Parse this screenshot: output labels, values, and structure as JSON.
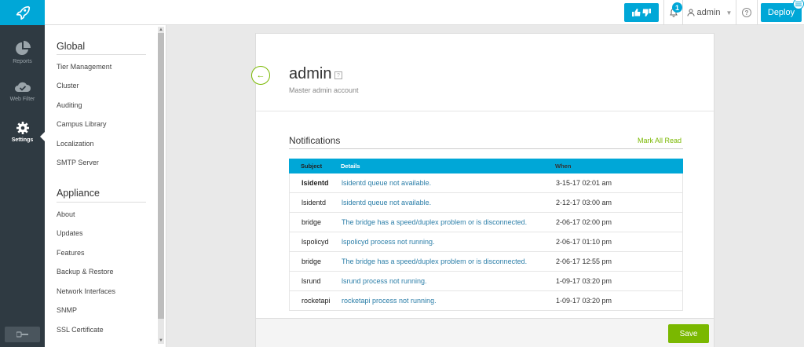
{
  "topbar": {
    "notification_count": "1",
    "user_label": "admin",
    "deploy_label": "Deploy"
  },
  "rail": {
    "items": [
      {
        "label": "Reports",
        "icon": "pie-chart-icon"
      },
      {
        "label": "Web Filter",
        "icon": "cloud-check-icon"
      },
      {
        "label": "Settings",
        "icon": "gear-icon"
      }
    ]
  },
  "menu": {
    "global_title": "Global",
    "global_items": [
      "Tier Management",
      "Cluster",
      "Auditing",
      "Campus Library",
      "Localization",
      "SMTP Server"
    ],
    "appliance_title": "Appliance",
    "appliance_items": [
      "About",
      "Updates",
      "Features",
      "Backup & Restore",
      "Network Interfaces",
      "SNMP",
      "SSL Certificate"
    ]
  },
  "page": {
    "title": "admin",
    "subtitle": "Master admin account"
  },
  "notifications": {
    "title": "Notifications",
    "mark_all_read": "Mark All Read",
    "columns": {
      "subject": "Subject",
      "details": "Details",
      "when": "When"
    },
    "rows": [
      {
        "subject": "lsidentd",
        "details": "lsidentd queue not available.",
        "when": "3-15-17 02:01 am",
        "unread": true
      },
      {
        "subject": "lsidentd",
        "details": "lsidentd queue not available.",
        "when": "2-12-17 03:00 am",
        "unread": false
      },
      {
        "subject": "bridge",
        "details": "The bridge has a speed/duplex problem or is disconnected.",
        "when": "2-06-17 02:00 pm",
        "unread": false
      },
      {
        "subject": "lspolicyd",
        "details": "lspolicyd process not running.",
        "when": "2-06-17 01:10 pm",
        "unread": false
      },
      {
        "subject": "bridge",
        "details": "The bridge has a speed/duplex problem or is disconnected.",
        "when": "2-06-17 12:55 pm",
        "unread": false
      },
      {
        "subject": "lsrund",
        "details": "lsrund process not running.",
        "when": "1-09-17 03:20 pm",
        "unread": false
      },
      {
        "subject": "rocketapi",
        "details": "rocketapi process not running.",
        "when": "1-09-17 03:20 pm",
        "unread": false
      }
    ]
  },
  "footer": {
    "save_label": "Save"
  },
  "colors": {
    "accent_blue": "#00a7d7",
    "accent_green": "#7ab800",
    "rail_bg": "#2f3a42"
  }
}
